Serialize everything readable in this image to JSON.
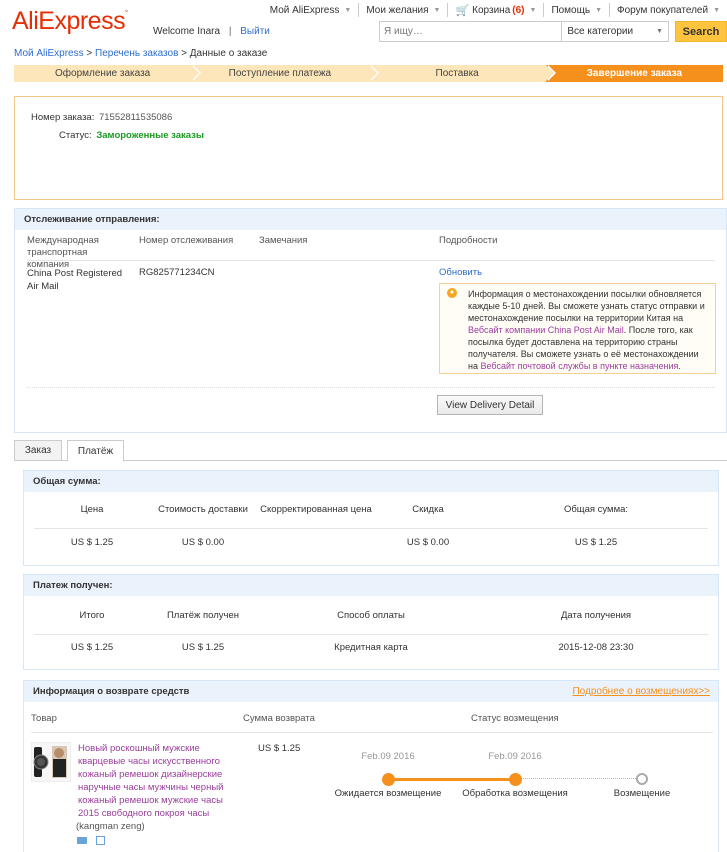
{
  "header": {
    "logo": "AliExpress",
    "welcome": "Welcome",
    "username": "Inara",
    "logout": "Выйти",
    "nav": {
      "my_ali": "Мой AliExpress",
      "wishlist": "Мои желания",
      "cart": "Корзина",
      "cart_count": "(6)",
      "help": "Помощь",
      "forum": "Форум покупателей"
    },
    "search_placeholder": "Я ищу…",
    "category": "Все категории",
    "search_button": "Search"
  },
  "breadcrumb": {
    "home": "Мой AliExpress",
    "sep1": " > ",
    "orders": "Перечень заказов",
    "sep2": " > ",
    "current": "Данные о заказе"
  },
  "steps": [
    "Оформление заказа",
    "Поступление платежа",
    "Поставка",
    "Завершение заказа"
  ],
  "order": {
    "number_label": "Номер заказа:",
    "number": "71552811535086",
    "status_label": "Статус:",
    "status": "Замороженные заказы"
  },
  "tracking": {
    "title": "Отслеживание отправления:",
    "col_company": "Международная транспортная компания",
    "col_number": "Номер отслеживания",
    "col_notes": "Замечания",
    "col_details": "Подробности",
    "company": "China Post Registered Air Mail",
    "number": "RG825771234CN",
    "refresh": "Обновить",
    "tip_1": "Информация о местонахождении посылки обновляется каждые 5-10 дней. Вы сможете узнать статус отправки и местонахождение посылки на территории Китая на ",
    "tip_link1": "Вебсайт компании China Post Air Mail",
    "tip_2": ". После того, как посылка будет доставлена на территорию страны получателя. Вы сможете узнать о её местонахождении на ",
    "tip_link2": "Вебсайт почтовой службы в пункте назначения",
    "tip_3": ".",
    "delivery_button": "View Delivery Detail"
  },
  "tabs": [
    "Заказ",
    "Платёж"
  ],
  "total": {
    "title": "Общая сумма:",
    "headers": [
      "Цена",
      "Стоимость доставки",
      "Скорректированная цена",
      "Скидка",
      "Общая сумма:"
    ],
    "values": [
      "US $ 1.25",
      "US $ 0.00",
      "",
      "US $ 0.00",
      "US $ 1.25"
    ]
  },
  "payment": {
    "title": "Платеж получен:",
    "headers": [
      "Итого",
      "Платёж получен",
      "Способ оплаты",
      "Дата получения"
    ],
    "values": [
      "US $ 1.25",
      "US $ 1.25",
      "Кредитная карта",
      "2015-12-08 23:30"
    ]
  },
  "refund": {
    "title": "Информация о возврате средств",
    "more_link": "Подробнее о возмещениях>>",
    "col_product": "Товар",
    "col_amount": "Сумма возврата",
    "col_status": "Статус возмещения",
    "product_title": "Новый роскошный мужские кварцевые часы искусственного кожаный ремешок дизайнерские наручные часы мужчины черный кожаный ремешок мужские часы 2015 свободного покроя часы",
    "seller": "(kangman zeng)",
    "amount": "US $ 1.25",
    "timeline": [
      {
        "date": "Feb.09 2016",
        "label": "Ожидается возмещение",
        "done": true
      },
      {
        "date": "Feb.09 2016",
        "label": "Обработка возмещения",
        "done": true
      },
      {
        "date": "",
        "label": "Возмещение",
        "done": false
      }
    ]
  },
  "colors": {
    "brand": "#e62e04",
    "step_active": "#f5901d",
    "step_inactive": "#fde6b9",
    "panel_header": "#eaf2fb",
    "status_green": "#1c9b23",
    "link_purple": "#9a3e9c",
    "link_blue": "#2e6dcf"
  }
}
